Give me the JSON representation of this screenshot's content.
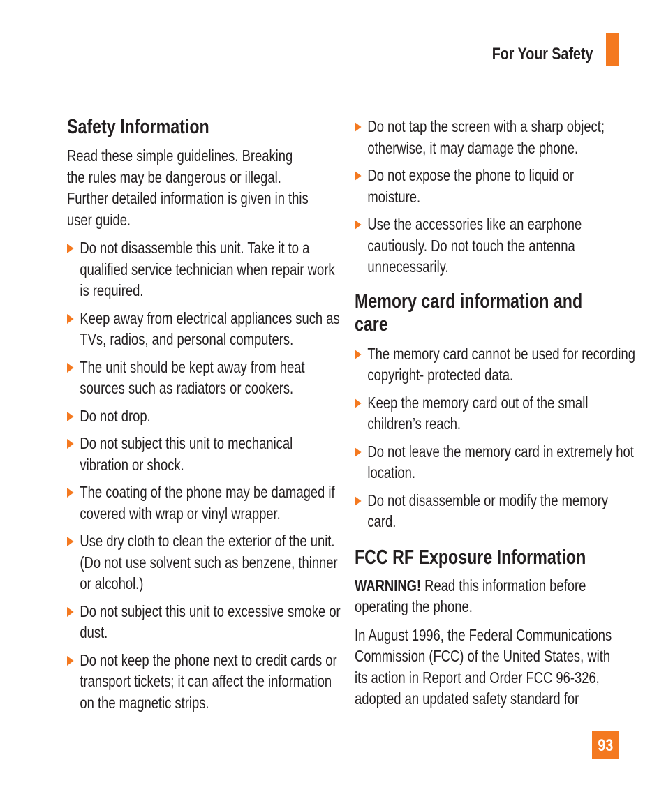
{
  "header": {
    "section_title": "For Your Safety",
    "accent_color": "#f47920"
  },
  "page_number": "93",
  "left": {
    "heading": "Safety Information",
    "intro": "Read these simple guidelines. Breaking the rules may be dangerous or illegal. Further detailed information is given in this user guide.",
    "bullets": [
      "Do not disassemble this unit. Take it to a qualified service technician when repair work is required.",
      "Keep away from electrical appliances such as TVs, radios, and personal computers.",
      "The unit should be kept away from heat sources such as radiators or cookers.",
      "Do not drop.",
      "Do not subject this unit to mechanical vibration or shock.",
      "The coating of the phone may be damaged if covered with wrap or vinyl wrapper.",
      "Use dry cloth to clean the exterior of the unit. (Do not use solvent such as benzene, thinner or alcohol.)",
      "Do not subject this unit to excessive smoke or dust.",
      "Do not keep the phone next to credit cards or transport tickets; it can affect the information on the magnetic strips."
    ]
  },
  "right": {
    "bullets_top": [
      "Do not tap the screen with a sharp object; otherwise, it may damage the phone.",
      "Do not expose the phone to liquid or moisture.",
      "Use the accessories like an earphone cautiously. Do not touch the antenna unnecessarily."
    ],
    "memory_heading": "Memory card information and care",
    "memory_bullets": [
      "The memory card cannot be used for recording copyright- protected data.",
      "Keep the memory card out of the small children’s reach.",
      "Do not leave the memory card in extremely hot location.",
      "Do not disassemble or modify the memory card."
    ],
    "fcc_heading": "FCC RF Exposure Information",
    "warning_label": "WARNING!",
    "warning_text": " Read this information before operating the phone.",
    "fcc_paragraph": "In August 1996, the Federal Communications Commission (FCC) of the United States, with its action in Report and Order FCC 96-326, adopted an updated safety standard for"
  }
}
